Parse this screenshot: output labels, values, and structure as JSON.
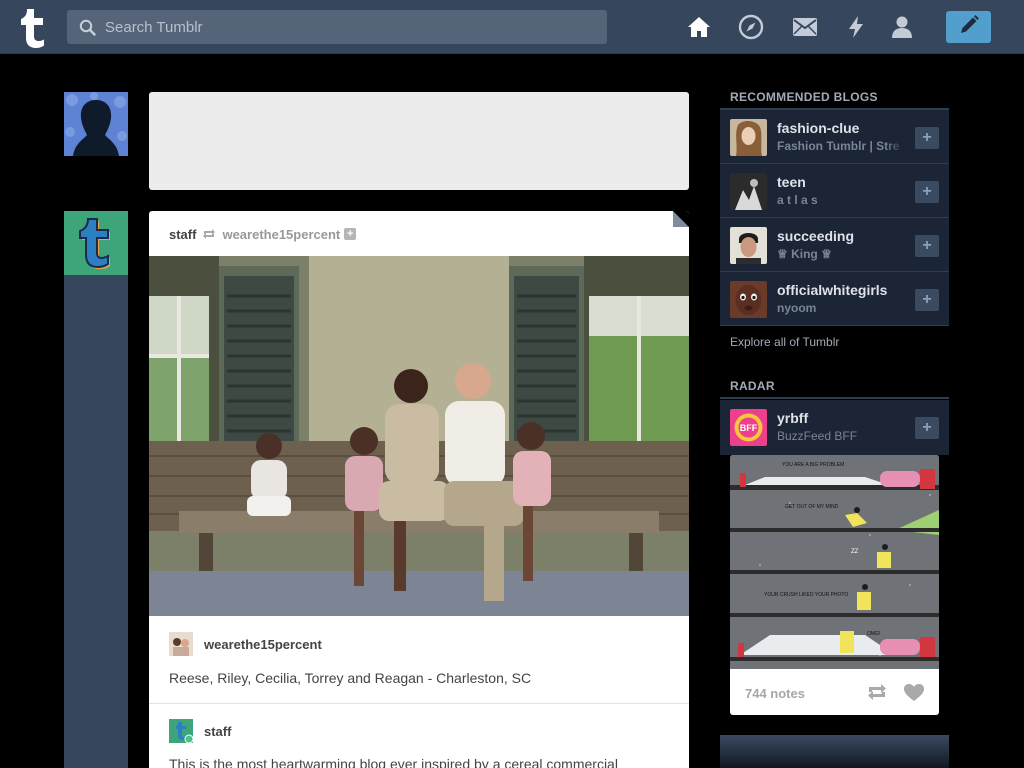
{
  "header": {
    "logo": "t",
    "search_placeholder": "Search Tumblr",
    "icons": [
      "home-icon",
      "explore-icon",
      "inbox-icon",
      "activity-icon",
      "account-icon",
      "compose-icon"
    ]
  },
  "colors": {
    "header_bg": "#36465d",
    "accent": "#529ecc",
    "page_bg": "#000000",
    "staff_avatar": "#3ea57b"
  },
  "post": {
    "author": "staff",
    "reblogged_from": "wearethe15percent",
    "caption_blog": "wearethe15percent",
    "caption_text": "Reese, Riley, Cecilia, Torrey and Reagan - Charleston, SC",
    "reblog_blog": "staff",
    "reblog_text": "This is the most heartwarming blog ever inspired by a cereal commercial"
  },
  "sidebar": {
    "recommended_title": "RECOMMENDED BLOGS",
    "recommended": [
      {
        "name": "fashion-clue",
        "title": "Fashion Tumblr | Stre"
      },
      {
        "name": "teen",
        "title": "a t l a s"
      },
      {
        "name": "succeeding",
        "title": "♕ King ♕"
      },
      {
        "name": "officialwhitegirls",
        "title": "nyoom"
      }
    ],
    "explore_label": "Explore all of Tumblr",
    "radar_title": "RADAR",
    "radar": {
      "name": "yrbff",
      "title": "BuzzFeed BFF",
      "notes": "744 notes",
      "comic_lines": [
        "YOU ARE A BIG PROBLEM",
        "GET OUT OF MY MIND",
        "ZZ",
        "YOUR CRUSH LIKED YOUR PHOTO",
        "OMG!"
      ]
    }
  }
}
